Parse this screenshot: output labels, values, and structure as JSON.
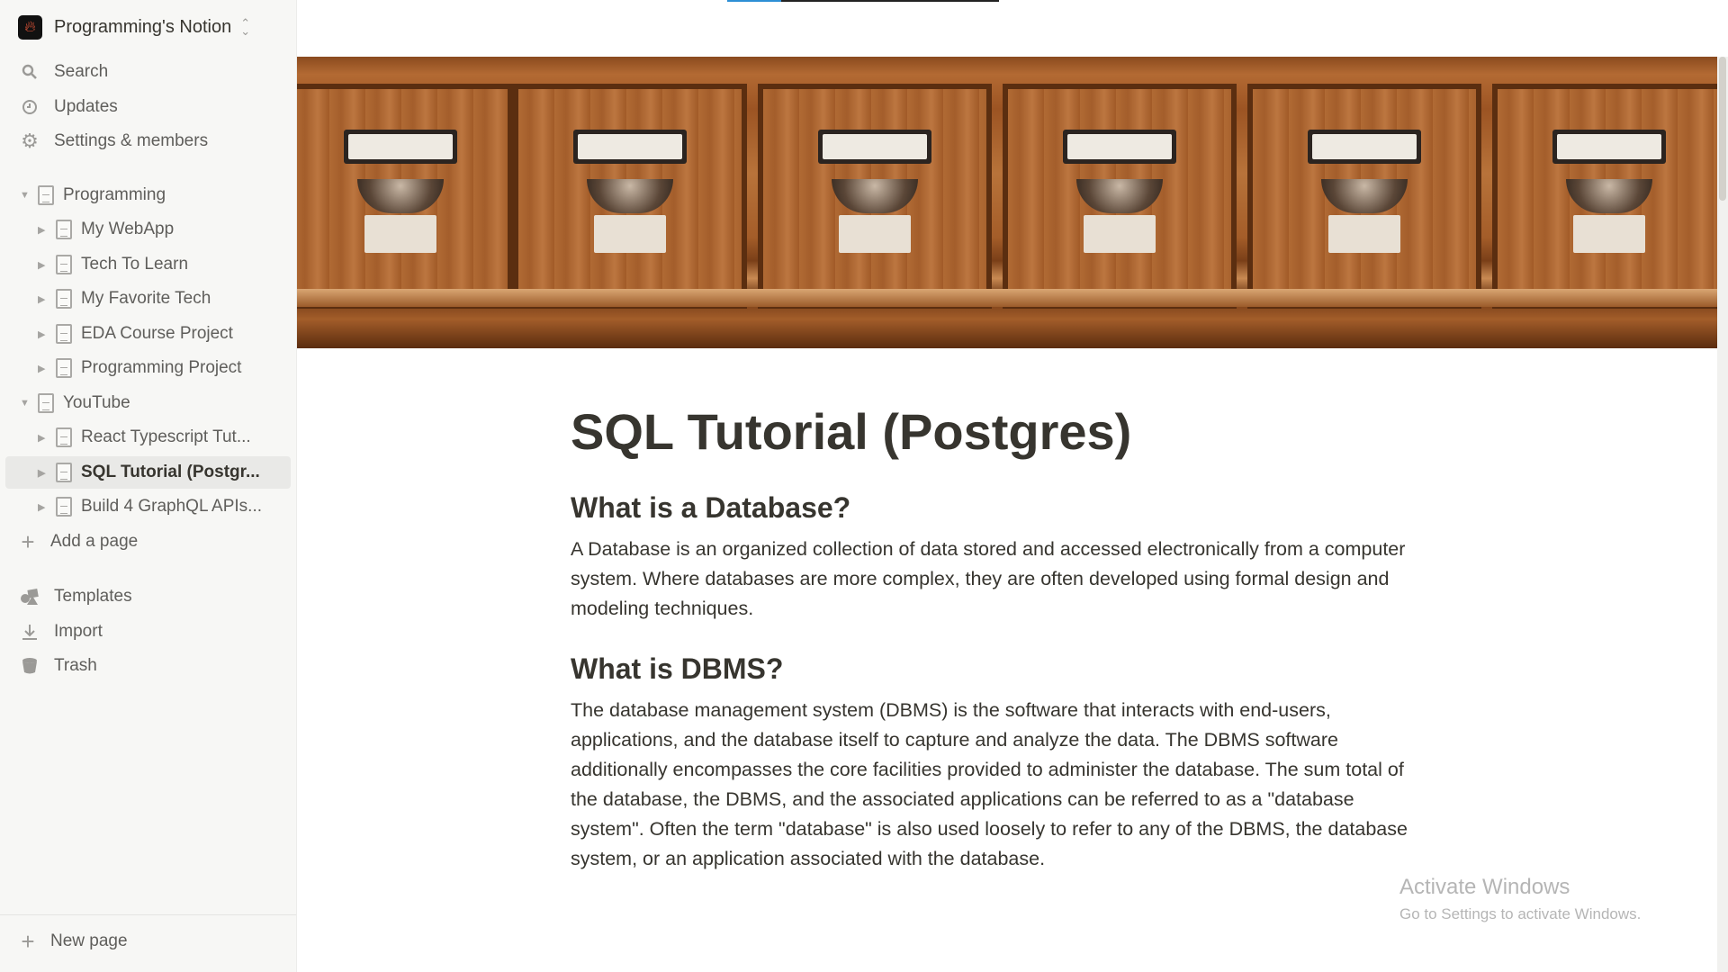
{
  "workspace": {
    "name": "Programming's Notion",
    "logo_icon": "flame-icon",
    "switch_icon": "chevron-up-down-icon"
  },
  "sidebar": {
    "top_items": [
      {
        "label": "Search",
        "icon": "search-icon"
      },
      {
        "label": "Updates",
        "icon": "clock-icon"
      },
      {
        "label": "Settings & members",
        "icon": "gear-icon"
      }
    ],
    "tree": [
      {
        "label": "Programming",
        "expanded": true,
        "children": [
          "My WebApp",
          "Tech To Learn",
          "My Favorite Tech",
          "EDA Course Project",
          "Programming Project"
        ]
      },
      {
        "label": "YouTube",
        "expanded": true,
        "children": [
          "React Typescript Tut...",
          "SQL Tutorial (Postgr...",
          "Build 4 GraphQL APIs..."
        ]
      }
    ],
    "selected": "SQL Tutorial (Postgr...",
    "add_page": "Add a page",
    "bottom_items": [
      {
        "label": "Templates",
        "icon": "templates-icon"
      },
      {
        "label": "Import",
        "icon": "download-icon"
      },
      {
        "label": "Trash",
        "icon": "trash-icon"
      }
    ],
    "new_page": "New page"
  },
  "page": {
    "title": "SQL Tutorial (Postgres)",
    "sections": [
      {
        "heading": "What is a Database?",
        "body": "A Database is an organized collection of data stored and accessed electronically from a computer system. Where databases are more complex, they are often developed using formal design and modeling techniques."
      },
      {
        "heading": "What is DBMS?",
        "body": "The database management system (DBMS) is the software that interacts with end-users, applications, and the database itself to capture and analyze the data. The DBMS software additionally encompasses the core facilities provided to administer the database. The sum total of the database, the DBMS, and the associated applications can be referred to as a \"database system\". Often the term \"database\" is also used loosely to refer to any of the DBMS, the database system, or an application associated with the database."
      }
    ]
  },
  "watermark": {
    "line1": "Activate Windows",
    "line2": "Go to Settings to activate Windows."
  },
  "colors": {
    "sidebar_bg": "#f7f7f5",
    "text": "#37352f",
    "loading_accent": "#2d8fd5"
  }
}
